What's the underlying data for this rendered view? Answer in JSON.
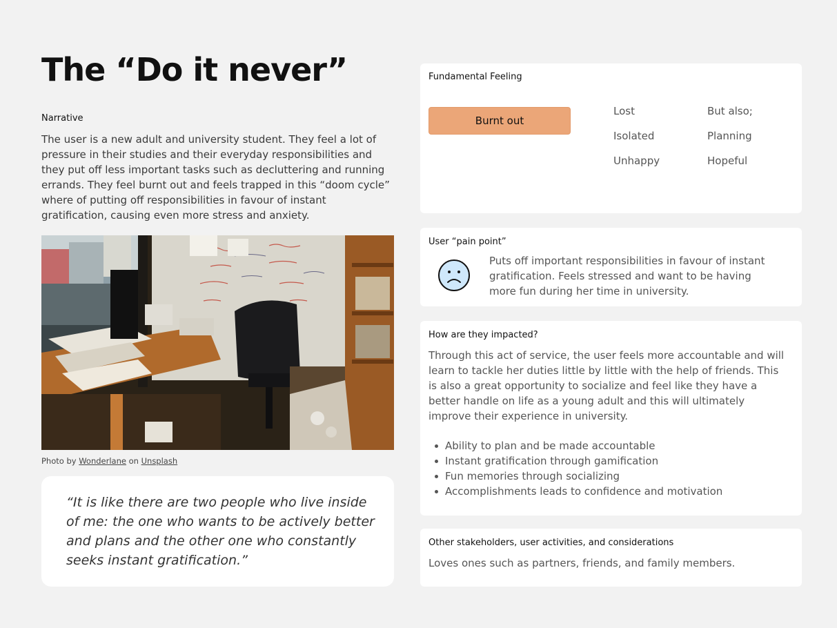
{
  "title": "The “Do it never”",
  "narrative": {
    "label": "Narrative",
    "text": "The user is a new adult and university student. They feel a lot of pressure in their studies and their everyday responsibilities and they put off less important tasks such as decluttering and running errands. They feel burnt out and feels trapped in this “doom cycle” where of putting off responsibilities in favour of instant gratification, causing even more stress and anxiety."
  },
  "photo": {
    "caption_prefix": "Photo by",
    "author": "Wonderlane",
    "caption_mid": "on",
    "source": "Unsplash"
  },
  "quote": "“It is like there are two people who live inside of me: the one who wants to be actively better and plans and the other one who constantly seeks instant gratification.”",
  "fundamental": {
    "title": "Fundamental Feeling",
    "primary": "Burnt out",
    "primary_color": "#eba678",
    "feelings": [
      "Lost",
      "Isolated",
      "Unhappy"
    ],
    "also_label": "But also;",
    "also": [
      "Planning",
      "Hopeful"
    ]
  },
  "pain": {
    "title": "User “pain point”",
    "icon": "sad-face-icon",
    "icon_color": "#cfe8fb",
    "text": "Puts off important responsibilities in favour of instant gratification. Feels stressed and want to be having more fun during her time in university."
  },
  "impact": {
    "title": "How are they impacted?",
    "text": "Through this act of service, the user feels more accountable and will learn to tackle her duties little by little with the help of friends. This is also a great opportunity to socialize and feel like they have a better handle on life as a young adult and this will ultimately improve their experience in university.",
    "bullets": [
      "Ability to plan and be made accountable",
      "Instant gratification through gamification",
      "Fun memories through socializing",
      "Accomplishments leads to confidence and motivation"
    ]
  },
  "stakeholders": {
    "title": "Other stakeholders, user activities, and considerations",
    "text": "Loves ones such as partners, friends, and family members."
  }
}
